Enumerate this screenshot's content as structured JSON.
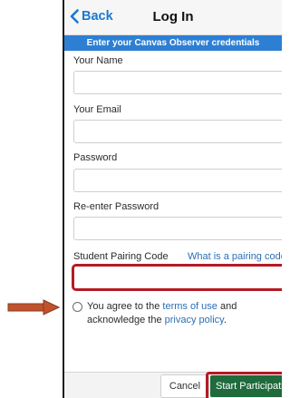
{
  "nav": {
    "back_label": "Back",
    "title": "Log In"
  },
  "banner": {
    "text": "Enter your Canvas Observer credentials"
  },
  "form": {
    "name_label": "Your Name",
    "name_value": "",
    "email_label": "Your Email",
    "email_value": "",
    "password_label": "Password",
    "password_value": "",
    "reenter_label": "Re-enter Password",
    "reenter_value": "",
    "pairing_label": "Student Pairing Code",
    "pairing_link": "What is a pairing code?",
    "pairing_value": ""
  },
  "agreement": {
    "prefix": "You agree to the ",
    "terms_link": "terms of use",
    "middle": " and acknowledge the ",
    "privacy_link": "privacy policy",
    "suffix": "."
  },
  "footer": {
    "cancel_label": "Cancel",
    "start_label": "Start Participating"
  },
  "colors": {
    "accent_blue": "#2d7fd3",
    "link_blue": "#1b78d0",
    "highlight_red": "#b31b24",
    "start_green": "#1f6b3c",
    "arrow_orange": "#c0532e"
  },
  "icons": {
    "back": "chevron-left-icon",
    "arrow": "right-arrow-icon"
  }
}
